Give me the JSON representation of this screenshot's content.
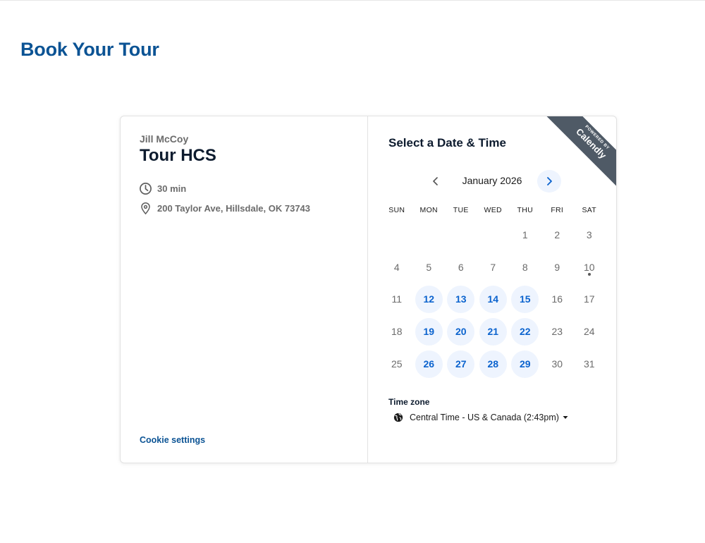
{
  "page": {
    "title": "Book Your Tour"
  },
  "event": {
    "organizer": "Jill McCoy",
    "title": "Tour HCS",
    "duration": "30 min",
    "location": "200 Taylor Ave, Hillsdale, OK 73743",
    "cookie_link": "Cookie settings"
  },
  "calendar": {
    "heading": "Select a Date & Time",
    "month_label": "January 2026",
    "weekdays": [
      "SUN",
      "MON",
      "TUE",
      "WED",
      "THU",
      "FRI",
      "SAT"
    ],
    "days": [
      {
        "label": "",
        "available": false
      },
      {
        "label": "",
        "available": false
      },
      {
        "label": "",
        "available": false
      },
      {
        "label": "",
        "available": false
      },
      {
        "label": "1",
        "available": false
      },
      {
        "label": "2",
        "available": false
      },
      {
        "label": "3",
        "available": false
      },
      {
        "label": "4",
        "available": false
      },
      {
        "label": "5",
        "available": false
      },
      {
        "label": "6",
        "available": false
      },
      {
        "label": "7",
        "available": false
      },
      {
        "label": "8",
        "available": false
      },
      {
        "label": "9",
        "available": false
      },
      {
        "label": "10",
        "available": false,
        "today": true
      },
      {
        "label": "11",
        "available": false
      },
      {
        "label": "12",
        "available": true
      },
      {
        "label": "13",
        "available": true
      },
      {
        "label": "14",
        "available": true
      },
      {
        "label": "15",
        "available": true
      },
      {
        "label": "16",
        "available": false
      },
      {
        "label": "17",
        "available": false
      },
      {
        "label": "18",
        "available": false
      },
      {
        "label": "19",
        "available": true
      },
      {
        "label": "20",
        "available": true
      },
      {
        "label": "21",
        "available": true
      },
      {
        "label": "22",
        "available": true
      },
      {
        "label": "23",
        "available": false
      },
      {
        "label": "24",
        "available": false
      },
      {
        "label": "25",
        "available": false
      },
      {
        "label": "26",
        "available": true
      },
      {
        "label": "27",
        "available": true
      },
      {
        "label": "28",
        "available": true
      },
      {
        "label": "29",
        "available": true
      },
      {
        "label": "30",
        "available": false
      },
      {
        "label": "31",
        "available": false
      }
    ]
  },
  "timezone": {
    "label": "Time zone",
    "value": "Central Time - US & Canada (2:43pm)"
  },
  "badge": {
    "line1": "POWERED BY",
    "line2": "Calendly"
  },
  "icons": {
    "clock": "clock-icon",
    "location": "location-pin-icon",
    "prev": "chevron-left-icon",
    "next": "chevron-right-icon",
    "globe": "globe-icon",
    "caret": "caret-down-icon"
  },
  "colors": {
    "brand": "#0b5394",
    "available_text": "#0b63ce",
    "available_bg": "#eef4fe",
    "ribbon": "#4f5a66"
  }
}
